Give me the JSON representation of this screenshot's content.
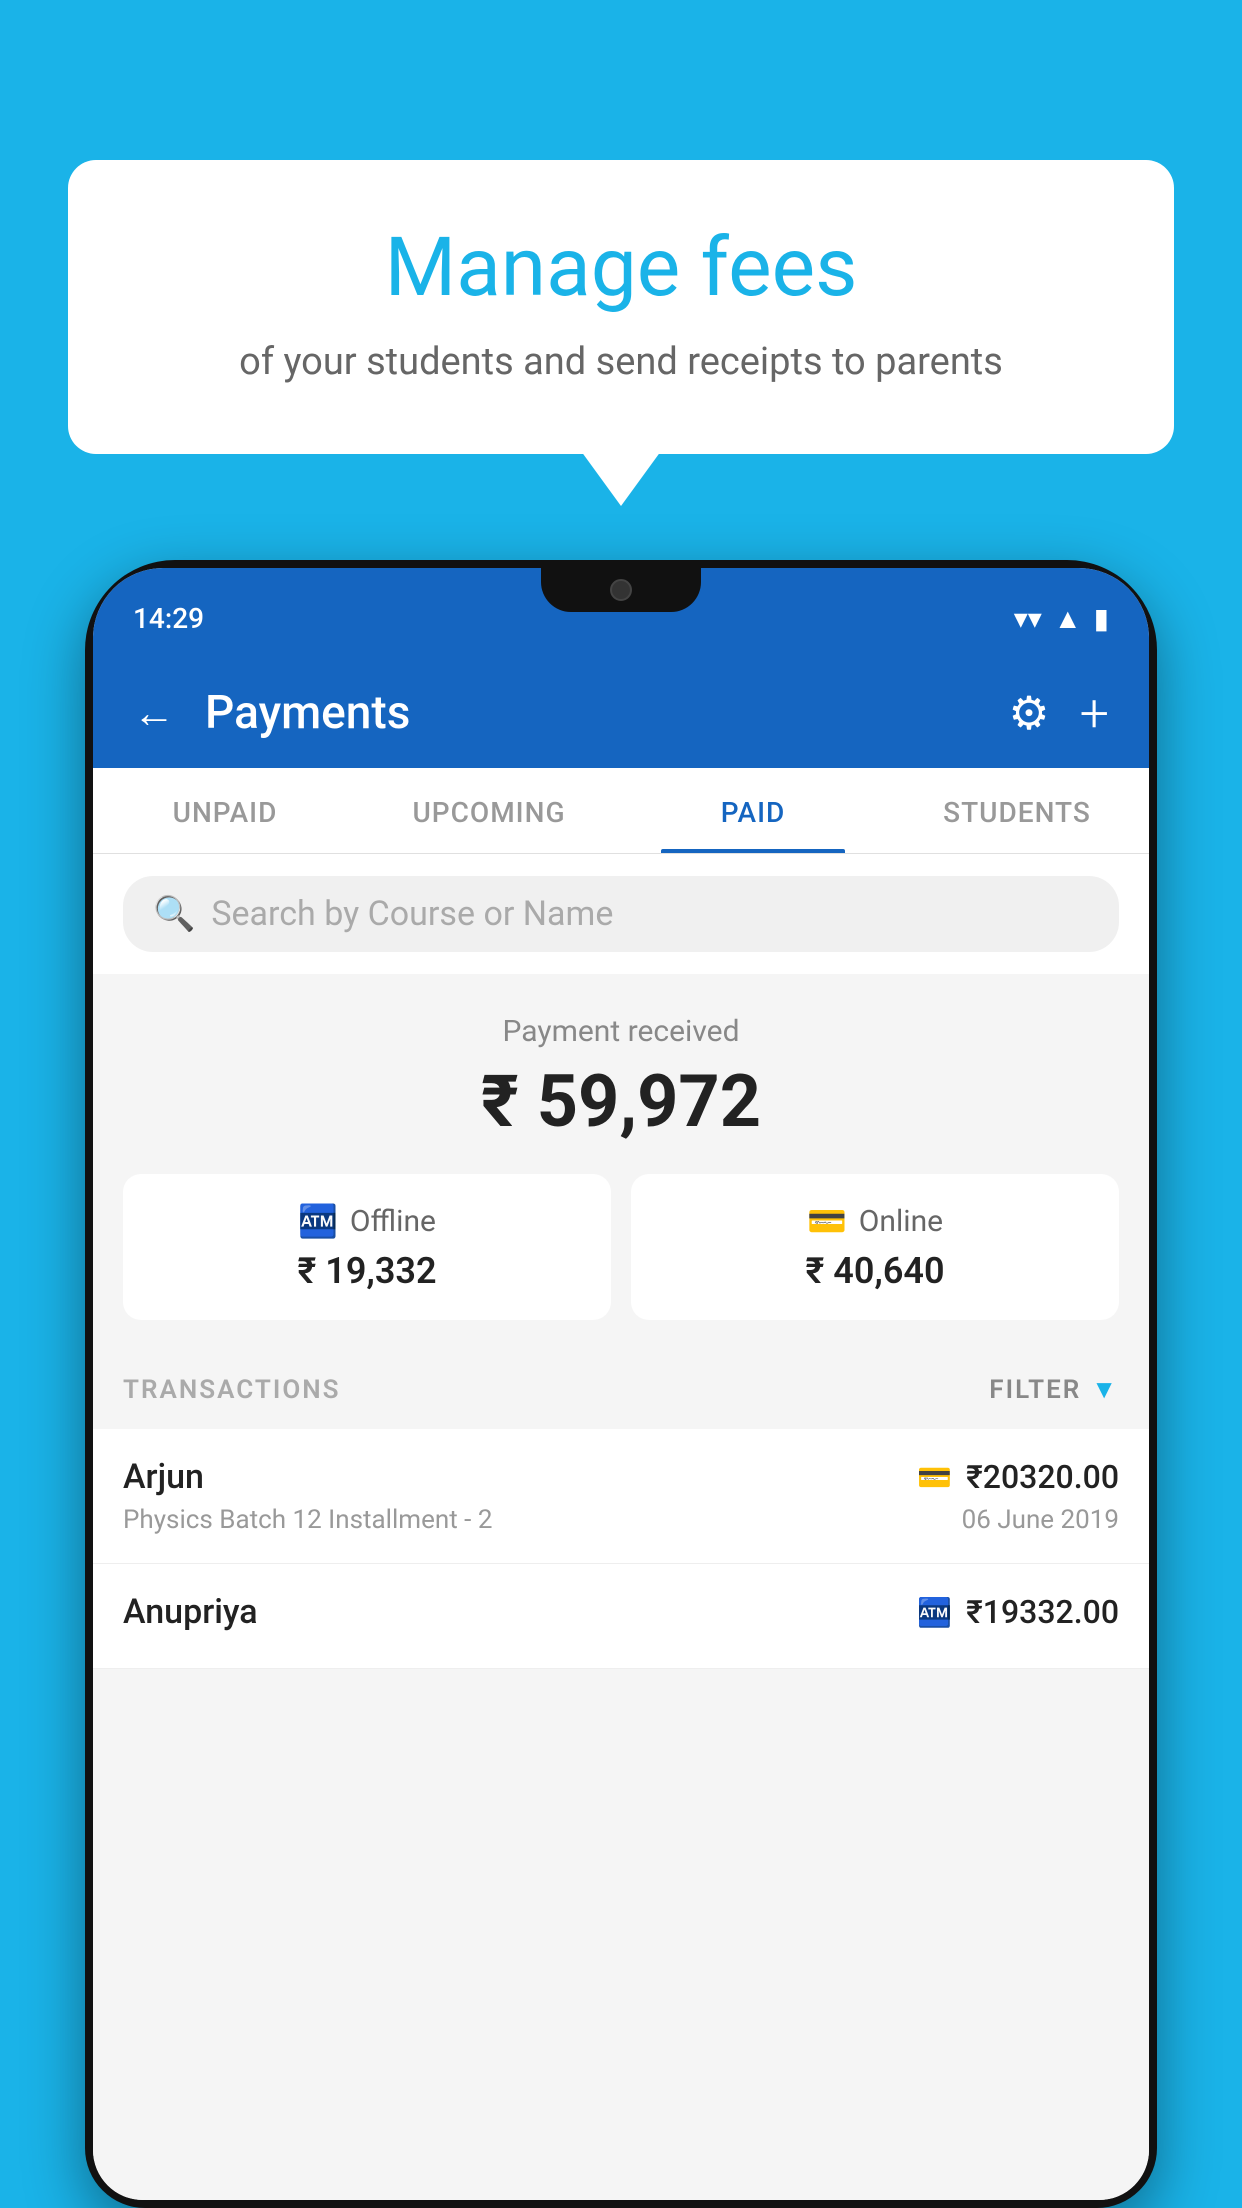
{
  "bubble": {
    "title": "Manage fees",
    "subtitle": "of your students and send receipts to parents"
  },
  "statusBar": {
    "time": "14:29"
  },
  "header": {
    "title": "Payments",
    "backLabel": "←",
    "gearLabel": "⚙",
    "plusLabel": "+"
  },
  "tabs": [
    {
      "label": "UNPAID",
      "active": false
    },
    {
      "label": "UPCOMING",
      "active": false
    },
    {
      "label": "PAID",
      "active": true
    },
    {
      "label": "STUDENTS",
      "active": false
    }
  ],
  "search": {
    "placeholder": "Search by Course or Name"
  },
  "paymentReceived": {
    "label": "Payment received",
    "total": "₹ 59,972",
    "offline": {
      "type": "Offline",
      "amount": "₹ 19,332"
    },
    "online": {
      "type": "Online",
      "amount": "₹ 40,640"
    }
  },
  "transactions": {
    "label": "TRANSACTIONS",
    "filter": "FILTER",
    "items": [
      {
        "name": "Arjun",
        "typeIcon": "card",
        "amount": "₹20320.00",
        "description": "Physics Batch 12 Installment - 2",
        "date": "06 June 2019"
      },
      {
        "name": "Anupriya",
        "typeIcon": "cash",
        "amount": "₹19332.00",
        "description": "",
        "date": ""
      }
    ]
  },
  "colors": {
    "primary": "#1565c0",
    "accent": "#1ab3e8",
    "background": "#1ab3e8"
  }
}
